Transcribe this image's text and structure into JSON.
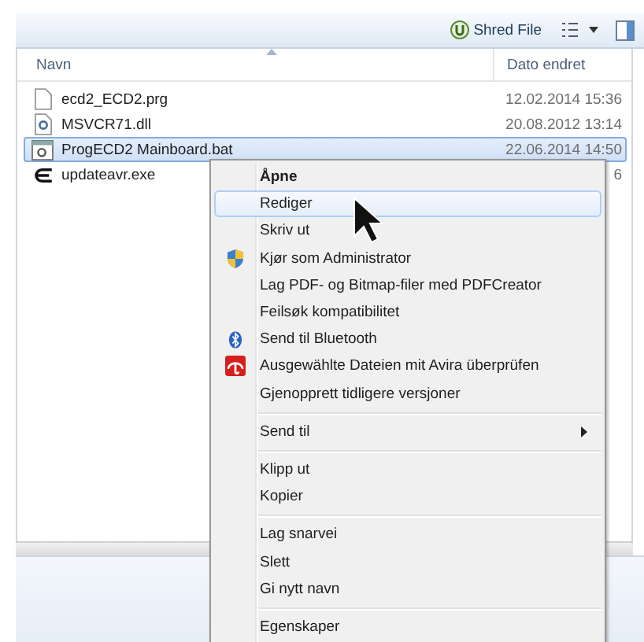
{
  "toolbar": {
    "shred_button": "Shred File"
  },
  "columns": [
    {
      "label": "Navn",
      "sorted": true
    },
    {
      "label": "Dato endret",
      "sorted": false
    }
  ],
  "files": [
    {
      "name": "ecd2_ECD2.prg",
      "date": "12.02.2014 15:36",
      "kind": "blank",
      "selected": false
    },
    {
      "name": "MSVCR71.dll",
      "date": "20.08.2012 13:14",
      "kind": "dll",
      "selected": false
    },
    {
      "name": "ProgECD2 Mainboard.bat",
      "date": "22.06.2014 14:50",
      "kind": "bat",
      "selected": true
    },
    {
      "name": "updateavr.exe",
      "date": "6",
      "kind": "exe",
      "selected": false
    }
  ],
  "context_menu": {
    "items": [
      {
        "kind": "plain",
        "label": "Åpne",
        "bold": true,
        "highlighted": false
      },
      {
        "kind": "plain",
        "label": "Rediger",
        "bold": false,
        "highlighted": true
      },
      {
        "kind": "plain",
        "label": "Skriv ut",
        "bold": false,
        "highlighted": false
      },
      {
        "kind": "shield",
        "label": "Kjør som Administrator",
        "bold": false,
        "highlighted": false
      },
      {
        "kind": "plain",
        "label": "Lag PDF- og Bitmap-filer med PDFCreator",
        "bold": false,
        "highlighted": false
      },
      {
        "kind": "plain",
        "label": "Feilsøk kompatibilitet",
        "bold": false,
        "highlighted": false
      },
      {
        "kind": "bluetooth",
        "label": "Send til Bluetooth",
        "bold": false,
        "highlighted": false
      },
      {
        "kind": "avira",
        "label": "Ausgewählte Dateien mit Avira überprüfen",
        "bold": false,
        "highlighted": false
      },
      {
        "kind": "plain",
        "label": "Gjenopprett tidligere versjoner",
        "bold": false,
        "highlighted": false
      },
      {
        "kind": "separator"
      },
      {
        "kind": "submenu",
        "label": "Send til",
        "bold": false,
        "highlighted": false
      },
      {
        "kind": "separator"
      },
      {
        "kind": "plain",
        "label": "Klipp ut",
        "bold": false,
        "highlighted": false
      },
      {
        "kind": "plain",
        "label": "Kopier",
        "bold": false,
        "highlighted": false
      },
      {
        "kind": "separator"
      },
      {
        "kind": "plain",
        "label": "Lag snarvei",
        "bold": false,
        "highlighted": false
      },
      {
        "kind": "plain",
        "label": "Slett",
        "bold": false,
        "highlighted": false
      },
      {
        "kind": "plain",
        "label": "Gi nytt navn",
        "bold": false,
        "highlighted": false
      },
      {
        "kind": "separator"
      },
      {
        "kind": "plain",
        "label": "Egenskaper",
        "bold": false,
        "highlighted": false
      }
    ]
  }
}
